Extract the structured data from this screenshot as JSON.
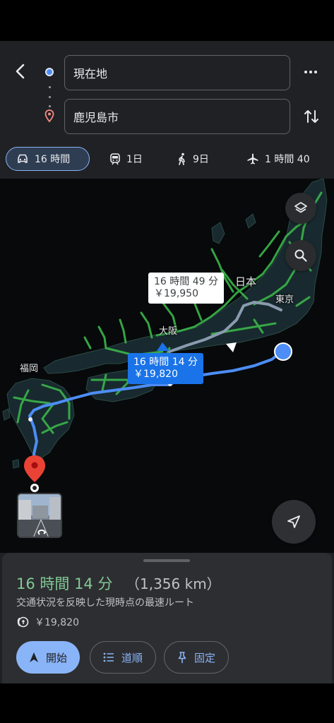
{
  "search": {
    "origin": "現在地",
    "destination": "鹿児島市"
  },
  "modes": [
    {
      "icon": "car-icon",
      "label": "16 時間",
      "active": true
    },
    {
      "icon": "train-icon",
      "label": "1日",
      "active": false
    },
    {
      "icon": "walk-icon",
      "label": "9日",
      "active": false
    },
    {
      "icon": "plane-icon",
      "label": "1 時間 40",
      "active": false
    }
  ],
  "map": {
    "country_label": "日本",
    "cities": {
      "osaka": "大阪",
      "fukuoka": "福岡",
      "tokyo": "東京"
    },
    "alt_route": {
      "time": "16 時間 49 分",
      "toll": "￥19,950"
    },
    "main_route": {
      "time": "16 時間 14 分",
      "toll": "￥19,820"
    },
    "colors": {
      "route": "#4d8df5",
      "alt_route": "#8a9bb0",
      "traffic": "#3bb54a",
      "land": "#1a2b30"
    }
  },
  "sheet": {
    "duration": "16 時間 14 分",
    "distance": "（1,356 km）",
    "note": "交通状況を反映した現時点の最速ルート",
    "toll": "￥19,820",
    "buttons": {
      "start": "開始",
      "steps": "道順",
      "pin": "固定"
    }
  }
}
